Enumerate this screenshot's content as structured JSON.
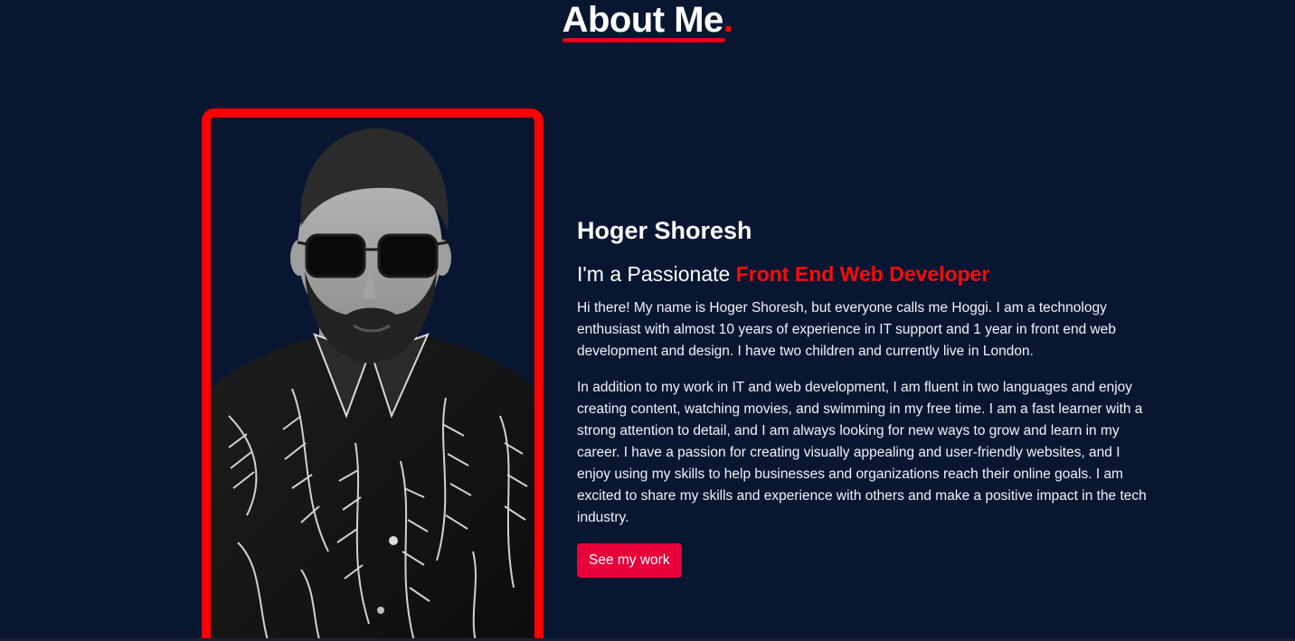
{
  "section": {
    "title": "About Me",
    "title_dot": "."
  },
  "profile": {
    "name": "Hoger Shoresh",
    "tagline_prefix": "I'm a Passionate ",
    "tagline_accent": "Front End Web Developer",
    "paragraphs": [
      "Hi there! My name is Hoger Shoresh, but everyone calls me Hoggi. I am a technology enthusiast with almost 10 years of experience in IT support and 1 year in front end web development and design. I have two children and currently live in London.",
      "In addition to my work in IT and web development, I am fluent in two languages and enjoy creating content, watching movies, and swimming in my free time. I am a fast learner with a strong attention to detail, and I am always looking for new ways to grow and learn in my career. I have a passion for creating visually appealing and user-friendly websites, and I enjoy using my skills to help businesses and organizations reach their online goals. I am excited to share my skills and experience with others and make a positive impact in the tech industry."
    ],
    "cta_label": "See my work"
  },
  "colors": {
    "background": "#081632",
    "accent_red": "#ff0000",
    "button": "#e8003a"
  },
  "icons": {
    "portrait": "portrait-photo"
  }
}
